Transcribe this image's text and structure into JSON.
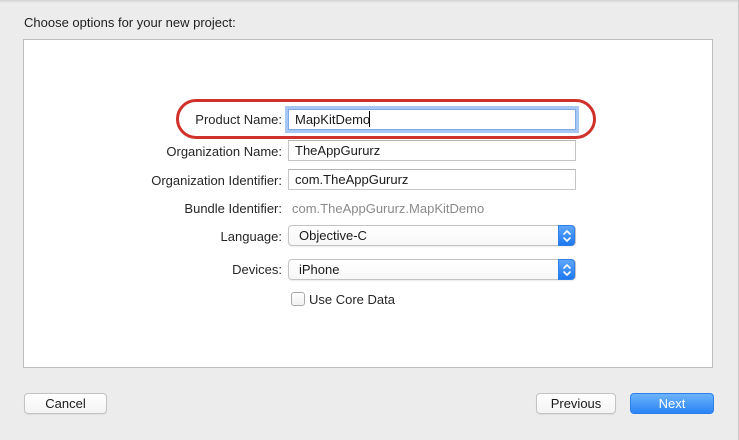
{
  "dialog": {
    "title": "Choose options for your new project:"
  },
  "form": {
    "product_name": {
      "label": "Product Name:",
      "value": "MapKitDemo"
    },
    "organization_name": {
      "label": "Organization Name:",
      "value": "TheAppGururz"
    },
    "organization_identifier": {
      "label": "Organization Identifier:",
      "value": "com.TheAppGururz"
    },
    "bundle_identifier": {
      "label": "Bundle Identifier:",
      "value": "com.TheAppGururz.MapKitDemo"
    },
    "language": {
      "label": "Language:",
      "value": "Objective-C"
    },
    "devices": {
      "label": "Devices:",
      "value": "iPhone"
    },
    "core_data": {
      "label": "Use Core Data",
      "checked": false
    }
  },
  "buttons": {
    "cancel": "Cancel",
    "previous": "Previous",
    "next": "Next"
  },
  "colors": {
    "accent": "#2a84f5",
    "highlight_ring": "#d0312a"
  }
}
